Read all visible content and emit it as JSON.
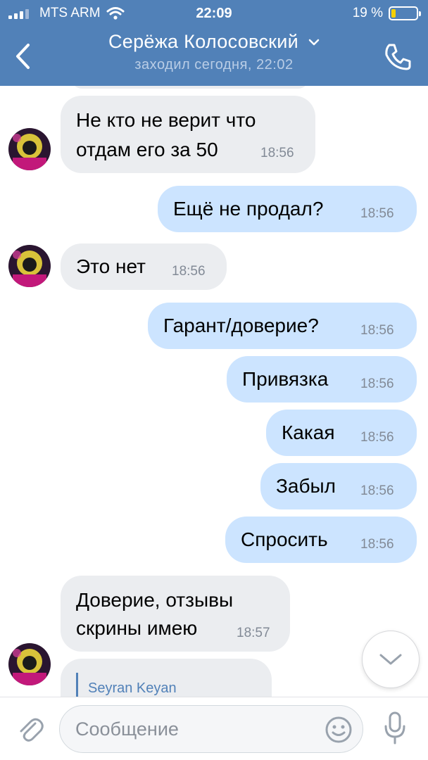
{
  "status_bar": {
    "carrier": "MTS ARM",
    "time": "22:09",
    "battery_percent": "19 %",
    "battery_level": 0.19,
    "battery_color": "#f5d000"
  },
  "header": {
    "title": "Серёжа Колосовский",
    "subtitle": "заходил сегодня, 22:02",
    "background": "#5181b8"
  },
  "messages": [
    {
      "direction": "in",
      "lines": [
        "Не кто не верит что",
        "отдам его за 50"
      ],
      "time": "18:56"
    },
    {
      "direction": "out",
      "text": "Ещё не продал?",
      "time": "18:56"
    },
    {
      "direction": "in",
      "text": "Это нет",
      "time": "18:56"
    },
    {
      "direction": "out",
      "text": "Гарант/доверие?",
      "time": "18:56"
    },
    {
      "direction": "out",
      "text": "Привязка",
      "time": "18:56"
    },
    {
      "direction": "out",
      "text": "Какая",
      "time": "18:56"
    },
    {
      "direction": "out",
      "text": "Забыл",
      "time": "18:56"
    },
    {
      "direction": "out",
      "text": "Спросить",
      "time": "18:56"
    },
    {
      "direction": "in",
      "lines": [
        "Доверие, отзывы",
        "скрины имею"
      ],
      "time": "18:57"
    },
    {
      "direction": "in",
      "reply_author": "Seyran Keyan"
    }
  ],
  "input": {
    "placeholder": "Сообщение",
    "value": ""
  },
  "icons": {
    "back": "chevron-left-icon",
    "call": "phone-icon",
    "attach": "paperclip-icon",
    "emoji": "smiley-icon",
    "mic": "microphone-icon",
    "scroll": "chevron-down-icon"
  }
}
